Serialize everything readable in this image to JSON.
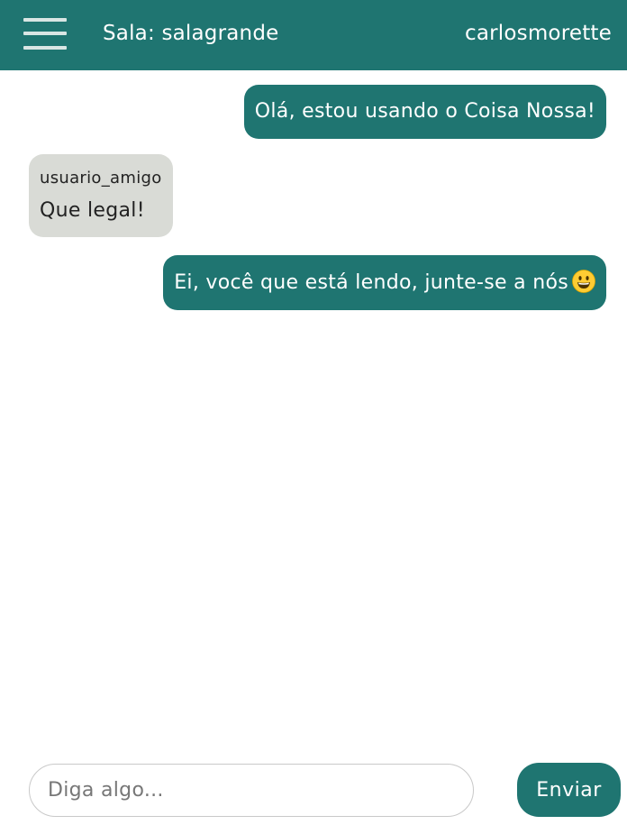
{
  "header": {
    "menu_icon": "hamburger-menu-icon",
    "room_title": "Sala: salagrande",
    "username": "carlosmorette"
  },
  "messages": [
    {
      "type": "sent",
      "text": "Olá, estou usando o Coisa Nossa!"
    },
    {
      "type": "received",
      "sender": "usuario_amigo",
      "text": "Que legal!"
    },
    {
      "type": "sent",
      "text": "Ei, você que está lendo, junte-se a nós",
      "emoji": "grinning-face-icon"
    }
  ],
  "composer": {
    "placeholder": "Diga algo...",
    "value": "",
    "send_label": "Enviar"
  },
  "colors": {
    "primary": "#1f7571",
    "received_bubble": "#d9dbd6",
    "menu_lines": "#d9e6e4"
  }
}
